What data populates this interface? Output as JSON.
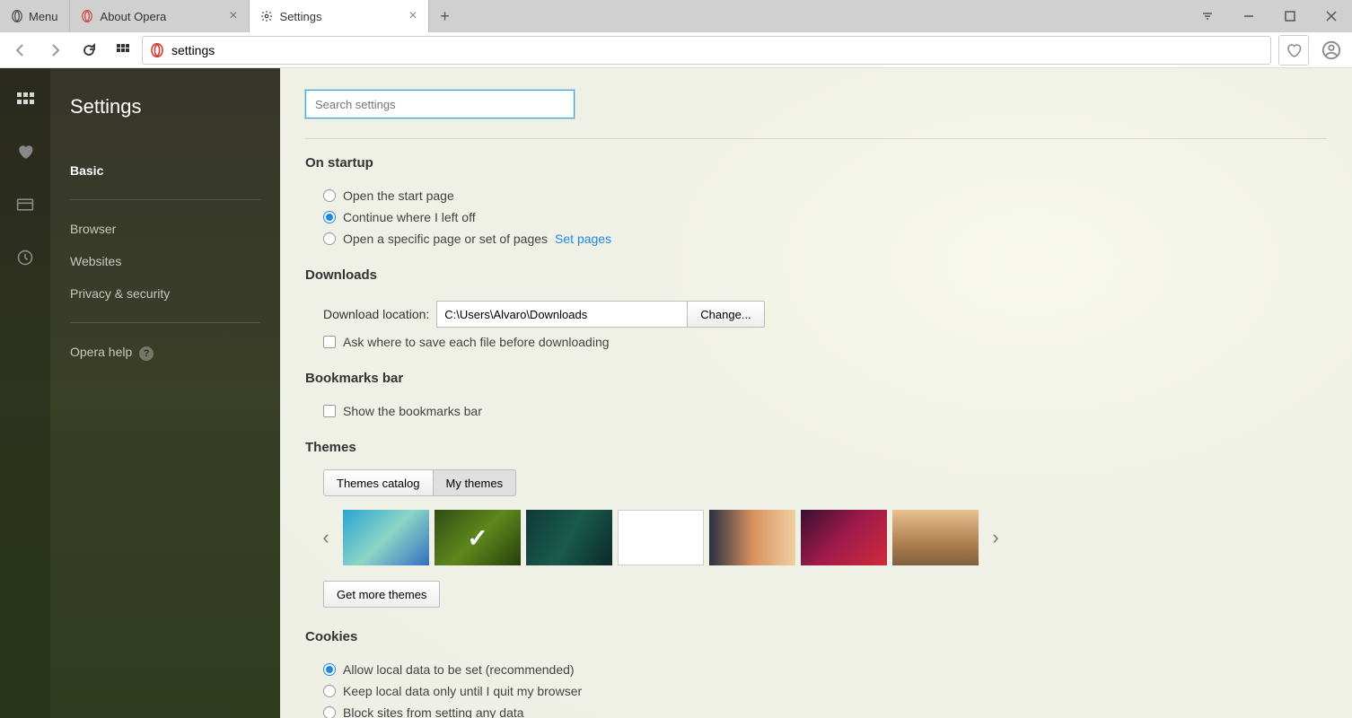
{
  "titlebar": {
    "menu": "Menu",
    "tabs": [
      {
        "label": "About Opera",
        "active": false
      },
      {
        "label": "Settings",
        "active": true
      }
    ]
  },
  "toolbar": {
    "address": "settings"
  },
  "sidebar": {
    "title": "Settings",
    "items": [
      {
        "label": "Basic",
        "active": true
      },
      {
        "label": "Browser"
      },
      {
        "label": "Websites"
      },
      {
        "label": "Privacy & security"
      }
    ],
    "help": "Opera help"
  },
  "search": {
    "placeholder": "Search settings"
  },
  "sections": {
    "startup": {
      "title": "On startup",
      "opt1": "Open the start page",
      "opt2": "Continue where I left off",
      "opt3": "Open a specific page or set of pages",
      "set_pages": "Set pages"
    },
    "downloads": {
      "title": "Downloads",
      "label": "Download location:",
      "path": "C:\\Users\\Alvaro\\Downloads",
      "change": "Change...",
      "ask": "Ask where to save each file before downloading"
    },
    "bookmarks": {
      "title": "Bookmarks bar",
      "show": "Show the bookmarks bar"
    },
    "themes": {
      "title": "Themes",
      "catalog": "Themes catalog",
      "my": "My themes",
      "more": "Get more themes"
    },
    "cookies": {
      "title": "Cookies",
      "opt1": "Allow local data to be set (recommended)",
      "opt2": "Keep local data only until I quit my browser",
      "opt3": "Block sites from setting any data"
    }
  }
}
